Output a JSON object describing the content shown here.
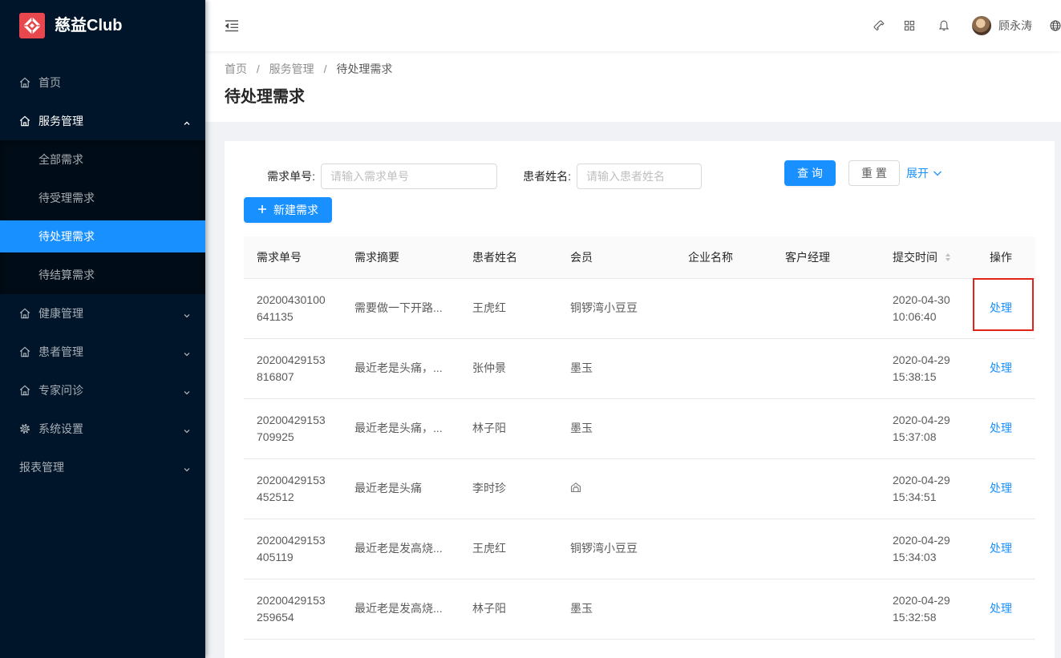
{
  "app": {
    "logo_text": "慈益Club",
    "logo_icon": "logo-icon"
  },
  "colors": {
    "primary": "#1890ff",
    "sidebar_bg": "#001529",
    "submenu_bg": "#000c17",
    "logo_bg": "#e9474e",
    "highlight_border": "#e2231a"
  },
  "sidebar": {
    "items": [
      {
        "label": "首页",
        "icon": "home-icon"
      },
      {
        "label": "服务管理",
        "icon": "home-icon",
        "expanded": true,
        "children": [
          {
            "label": "全部需求"
          },
          {
            "label": "待受理需求"
          },
          {
            "label": "待处理需求",
            "selected": true
          },
          {
            "label": "待结算需求"
          }
        ]
      },
      {
        "label": "健康管理",
        "icon": "home-icon"
      },
      {
        "label": "患者管理",
        "icon": "home-icon"
      },
      {
        "label": "专家问诊",
        "icon": "home-icon"
      },
      {
        "label": "系统设置",
        "icon": "gear-icon"
      },
      {
        "label": "报表管理"
      }
    ]
  },
  "header": {
    "user_name": "顾永涛",
    "icons": [
      "menu-fold-icon",
      "phone-icon",
      "appstore-icon",
      "bell-icon",
      "globe-icon"
    ]
  },
  "breadcrumb": {
    "items": [
      "首页",
      "服务管理",
      "待处理需求"
    ],
    "separator": "/"
  },
  "page_title": "待处理需求",
  "search": {
    "order_no": {
      "label": "需求单号:",
      "placeholder": "请输入需求单号"
    },
    "patient_name": {
      "label": "患者姓名:",
      "placeholder": "请输入患者姓名"
    },
    "query_label": "查 询",
    "reset_label": "重 置",
    "expand_label": "展开"
  },
  "toolbar": {
    "new_label": "新建需求"
  },
  "table": {
    "columns": [
      "需求单号",
      "需求摘要",
      "患者姓名",
      "会员",
      "企业名称",
      "客户经理",
      "提交时间",
      "操作"
    ],
    "sortable_column": "提交时间",
    "rows": [
      {
        "id": "20200430100641135",
        "summary": "需要做一下开路...",
        "patient": "王虎红",
        "member": "铜锣湾小豆豆",
        "company": "",
        "manager": "",
        "submitted": "2020-04-30 10:06:40",
        "action": "处理",
        "highlighted": true
      },
      {
        "id": "20200429153816807",
        "summary": "最近老是头痛，...",
        "patient": "张仲景",
        "member": "墨玉",
        "company": "",
        "manager": "",
        "submitted": "2020-04-29 15:38:15",
        "action": "处理"
      },
      {
        "id": "20200429153709925",
        "summary": "最近老是头痛，...",
        "patient": "林子阳",
        "member": "墨玉",
        "company": "",
        "manager": "",
        "submitted": "2020-04-29 15:37:08",
        "action": "处理"
      },
      {
        "id": "20200429153452512",
        "summary": "最近老是头痛",
        "patient": "李时珍",
        "member": "",
        "member_icon": "emoji-icon",
        "company": "",
        "manager": "",
        "submitted": "2020-04-29 15:34:51",
        "action": "处理"
      },
      {
        "id": "20200429153405119",
        "summary": "最近老是发高烧...",
        "patient": "王虎红",
        "member": "铜锣湾小豆豆",
        "company": "",
        "manager": "",
        "submitted": "2020-04-29 15:34:03",
        "action": "处理"
      },
      {
        "id": "20200429153259654",
        "summary": "最近老是发高烧...",
        "patient": "林子阳",
        "member": "墨玉",
        "company": "",
        "manager": "",
        "submitted": "2020-04-29 15:32:58",
        "action": "处理"
      }
    ]
  }
}
